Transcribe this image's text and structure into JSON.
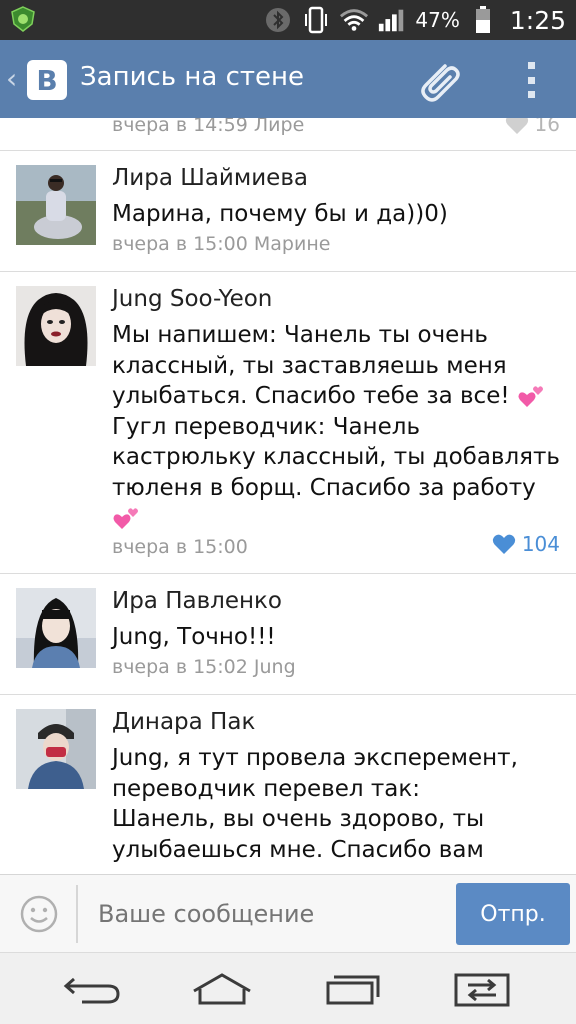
{
  "status_bar": {
    "battery_percent": "47%",
    "time": "1:25",
    "icons": [
      "app-shield-icon",
      "bluetooth-icon",
      "vibrate-icon",
      "wifi-icon",
      "signal-icon",
      "battery-icon"
    ]
  },
  "app_bar": {
    "back_glyph": "‹",
    "logo_letter": "B",
    "title": "Запись на стене",
    "icons": [
      "paperclip-icon",
      "overflow-menu-icon"
    ]
  },
  "comments": [
    {
      "name": "",
      "text": "",
      "meta": "вчера в 14:59 Лире",
      "likes": "16",
      "liked": false
    },
    {
      "name": "Лира Шаймиева",
      "text": "Марина, почему бы и да))0)",
      "meta": "вчера в 15:00 Марине",
      "likes": "",
      "liked": false
    },
    {
      "name": "Jung Soo-Yeon",
      "text_lines": [
        "Мы напишем: Чанель ты очень",
        "классный, ты заставляешь меня",
        "улыбаться. Спасибо тебе за все!",
        "Гугл переводчик: Чанель",
        "кастрюльку классный, ты добавлять",
        "тюленя в борщ. Спасибо за работу"
      ],
      "meta": "вчера в 15:00",
      "likes": "104",
      "liked": true
    },
    {
      "name": "Ира Павленко",
      "text": "Jung, Точно!!!",
      "meta": "вчера в 15:02 Jung",
      "likes": "",
      "liked": false
    },
    {
      "name": "Динара Пак",
      "text_lines": [
        "Jung, я тут провела эксперемент,",
        "переводчик перевел так:",
        "Шанель, вы очень здорово, ты",
        "улыбаешься мне. Спасибо вам"
      ],
      "meta": "",
      "likes": "",
      "liked": false
    }
  ],
  "input_bar": {
    "placeholder": "Ваше сообщение",
    "send_label": "Отпр.",
    "icons": [
      "smiley-icon"
    ]
  },
  "nav_bar": {
    "icons": [
      "back-icon",
      "home-icon",
      "recent-apps-icon",
      "switch-icon"
    ]
  },
  "colors": {
    "app_bar": "#5a7fad",
    "status_bar": "#2f2f2f",
    "like_active": "#4a8ed6",
    "send_button": "#5b8ac4"
  }
}
